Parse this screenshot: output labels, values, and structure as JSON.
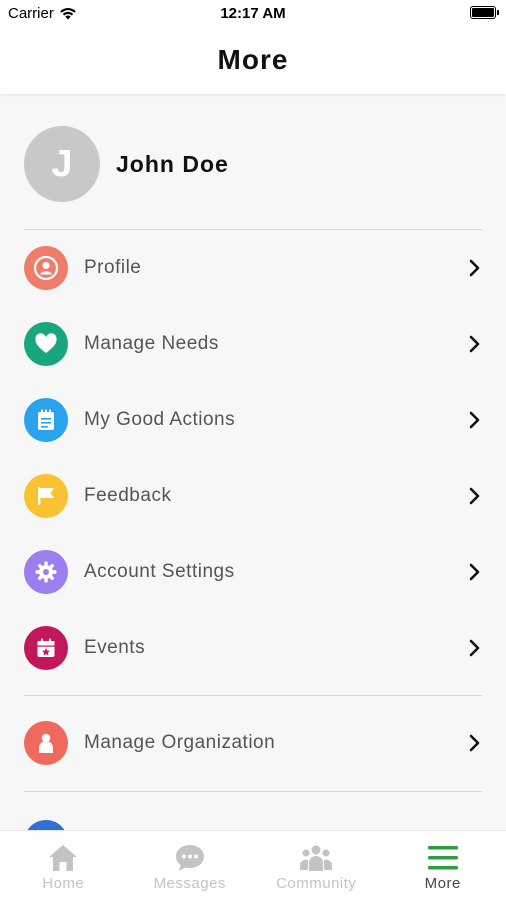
{
  "status_bar": {
    "carrier": "Carrier",
    "time": "12:17 AM"
  },
  "header": {
    "title": "More"
  },
  "user": {
    "initial": "J",
    "name": "John Doe",
    "avatar_color": "#c8c8c8"
  },
  "menu": [
    {
      "label": "Profile",
      "icon": "person-icon",
      "color": "#f07c6c"
    },
    {
      "label": "Manage Needs",
      "icon": "heart-icon",
      "color": "#19a67e"
    },
    {
      "label": "My Good Actions",
      "icon": "notepad-icon",
      "color": "#2ba3ec"
    },
    {
      "label": "Feedback",
      "icon": "flag-icon",
      "color": "#f9c232"
    },
    {
      "label": "Account Settings",
      "icon": "gear-icon",
      "color": "#9b7ef0"
    },
    {
      "label": "Events",
      "icon": "calendar-icon",
      "color": "#c2185b"
    },
    {
      "label": "Manage Organization",
      "icon": "person-icon",
      "color": "#ef6a5d"
    }
  ],
  "tabs": [
    {
      "label": "Home",
      "icon": "home-icon"
    },
    {
      "label": "Messages",
      "icon": "chat-icon"
    },
    {
      "label": "Community",
      "icon": "people-icon"
    },
    {
      "label": "More",
      "icon": "hamburger-icon",
      "active": true
    }
  ],
  "colors": {
    "active_tab_icon": "#2e9e3c",
    "inactive_tab": "#c3c3c3"
  }
}
